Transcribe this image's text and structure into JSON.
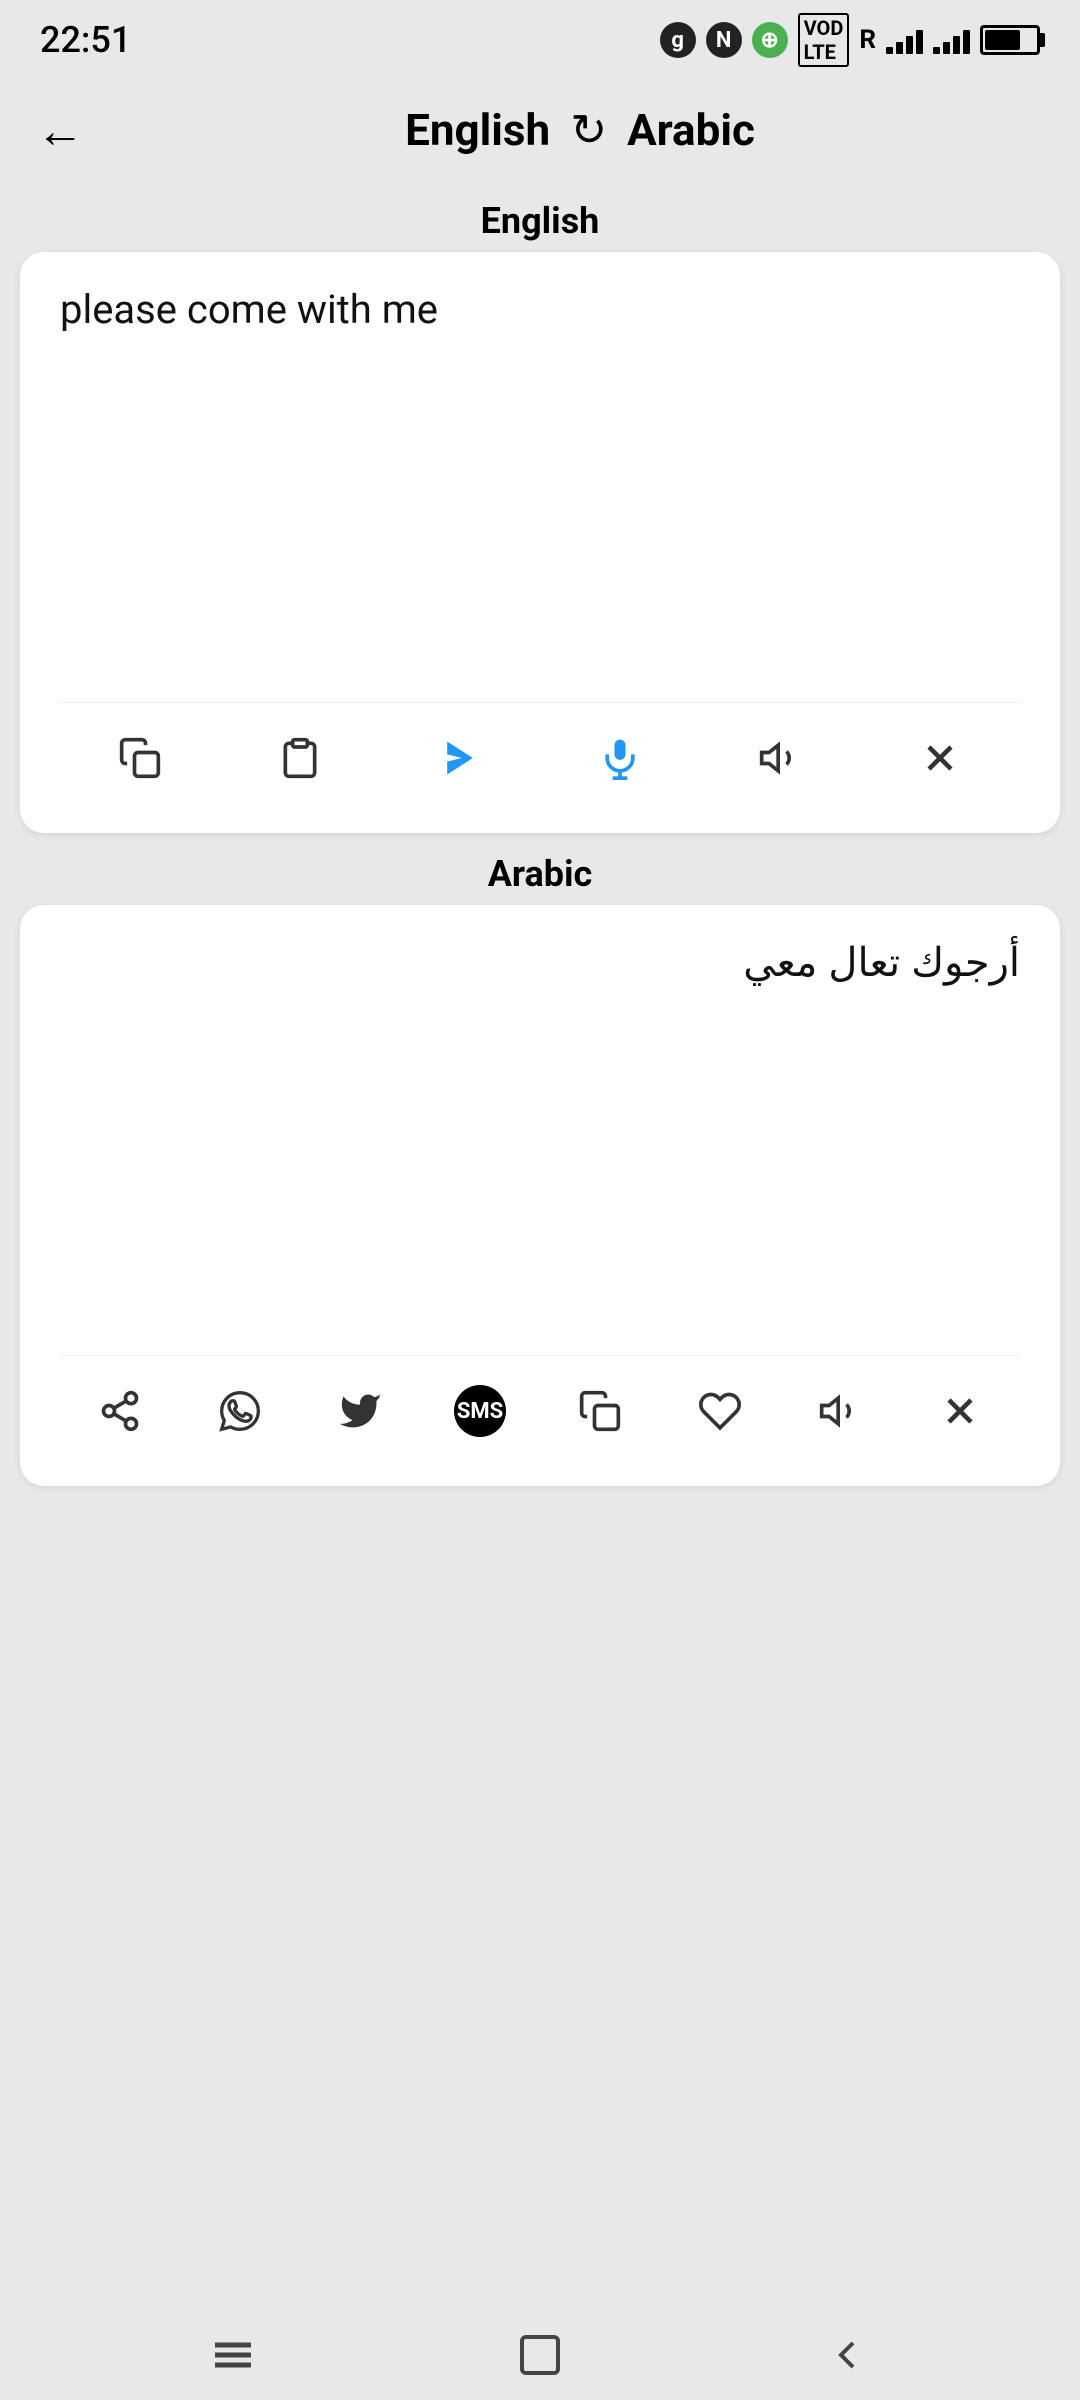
{
  "statusBar": {
    "time": "22:51",
    "icons": [
      "g",
      "N",
      "⊙"
    ]
  },
  "header": {
    "backLabel": "←",
    "sourceLang": "English",
    "swapIcon": "↻",
    "targetLang": "Arabic"
  },
  "sourceSection": {
    "label": "English",
    "text": "please come with me",
    "toolbar": {
      "copy_icon": "copy",
      "clipboard_icon": "clipboard",
      "translate_icon": "translate",
      "mic_icon": "microphone",
      "speaker_icon": "speaker",
      "clear_icon": "clear"
    }
  },
  "targetSection": {
    "label": "Arabic",
    "text": "أرجوك تعال معي",
    "toolbar": {
      "share_icon": "share",
      "whatsapp_icon": "whatsapp",
      "twitter_icon": "twitter",
      "sms_icon": "SMS",
      "copy_icon": "copy",
      "heart_icon": "heart",
      "speaker_icon": "speaker",
      "clear_icon": "clear"
    }
  },
  "bottomNav": {
    "menu_icon": "menu",
    "home_icon": "home",
    "back_icon": "back"
  }
}
